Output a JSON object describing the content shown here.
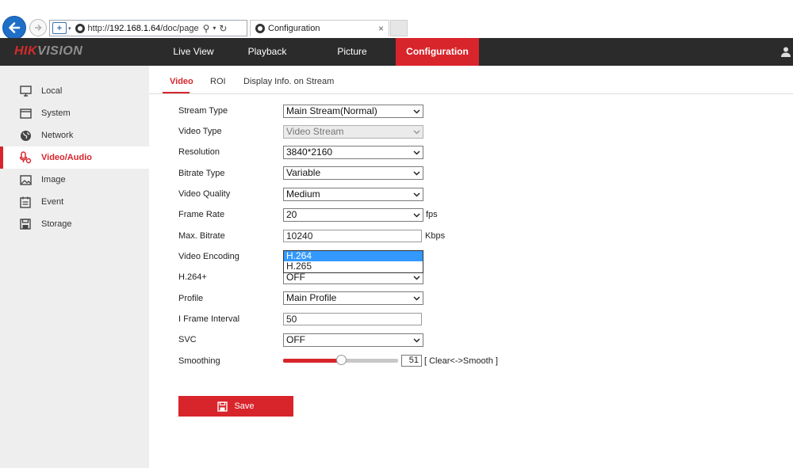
{
  "browser": {
    "url_prefix": "http://",
    "url_host": "192.168.1.64",
    "url_path": "/doc/page",
    "search_glyph": "⚲",
    "dropdown_glyph": "▾",
    "refresh_glyph": "↻",
    "tab_title": "Configuration",
    "tab_close": "×"
  },
  "brand": {
    "part1": "HIK",
    "part2": "VISION",
    "accent": "#d8252b"
  },
  "nav": {
    "items": [
      {
        "label": "Live View"
      },
      {
        "label": "Playback"
      },
      {
        "label": "Picture"
      },
      {
        "label": "Configuration",
        "active": true
      }
    ]
  },
  "sidebar": {
    "items": [
      {
        "label": "Local",
        "icon": "monitor-icon"
      },
      {
        "label": "System",
        "icon": "window-icon"
      },
      {
        "label": "Network",
        "icon": "globe-icon"
      },
      {
        "label": "Video/Audio",
        "icon": "microphone-icon",
        "active": true
      },
      {
        "label": "Image",
        "icon": "picture-icon"
      },
      {
        "label": "Event",
        "icon": "calendar-icon"
      },
      {
        "label": "Storage",
        "icon": "disk-icon"
      }
    ]
  },
  "subtabs": [
    {
      "label": "Video",
      "active": true
    },
    {
      "label": "ROI"
    },
    {
      "label": "Display Info. on Stream"
    }
  ],
  "form": {
    "stream_type": {
      "label": "Stream Type",
      "value": "Main Stream(Normal)"
    },
    "video_type": {
      "label": "Video Type",
      "value": "Video Stream",
      "disabled": true
    },
    "resolution": {
      "label": "Resolution",
      "value": "3840*2160"
    },
    "bitrate_type": {
      "label": "Bitrate Type",
      "value": "Variable"
    },
    "video_quality": {
      "label": "Video Quality",
      "value": "Medium"
    },
    "frame_rate": {
      "label": "Frame Rate",
      "value": "20",
      "unit": "fps"
    },
    "max_bitrate": {
      "label": "Max. Bitrate",
      "value": "10240",
      "unit": "Kbps"
    },
    "video_encoding": {
      "label": "Video Encoding",
      "options": [
        "H.264",
        "H.265"
      ],
      "highlighted": "H.264"
    },
    "h264plus": {
      "label": "H.264+",
      "value": "OFF"
    },
    "profile": {
      "label": "Profile",
      "value": "Main Profile"
    },
    "i_frame_interval": {
      "label": "I Frame Interval",
      "value": "50"
    },
    "svc": {
      "label": "SVC",
      "value": "OFF"
    },
    "smoothing": {
      "label": "Smoothing",
      "value": "51",
      "level": 0.51,
      "hint": "[ Clear<->Smooth ]"
    }
  },
  "save_label": "Save"
}
